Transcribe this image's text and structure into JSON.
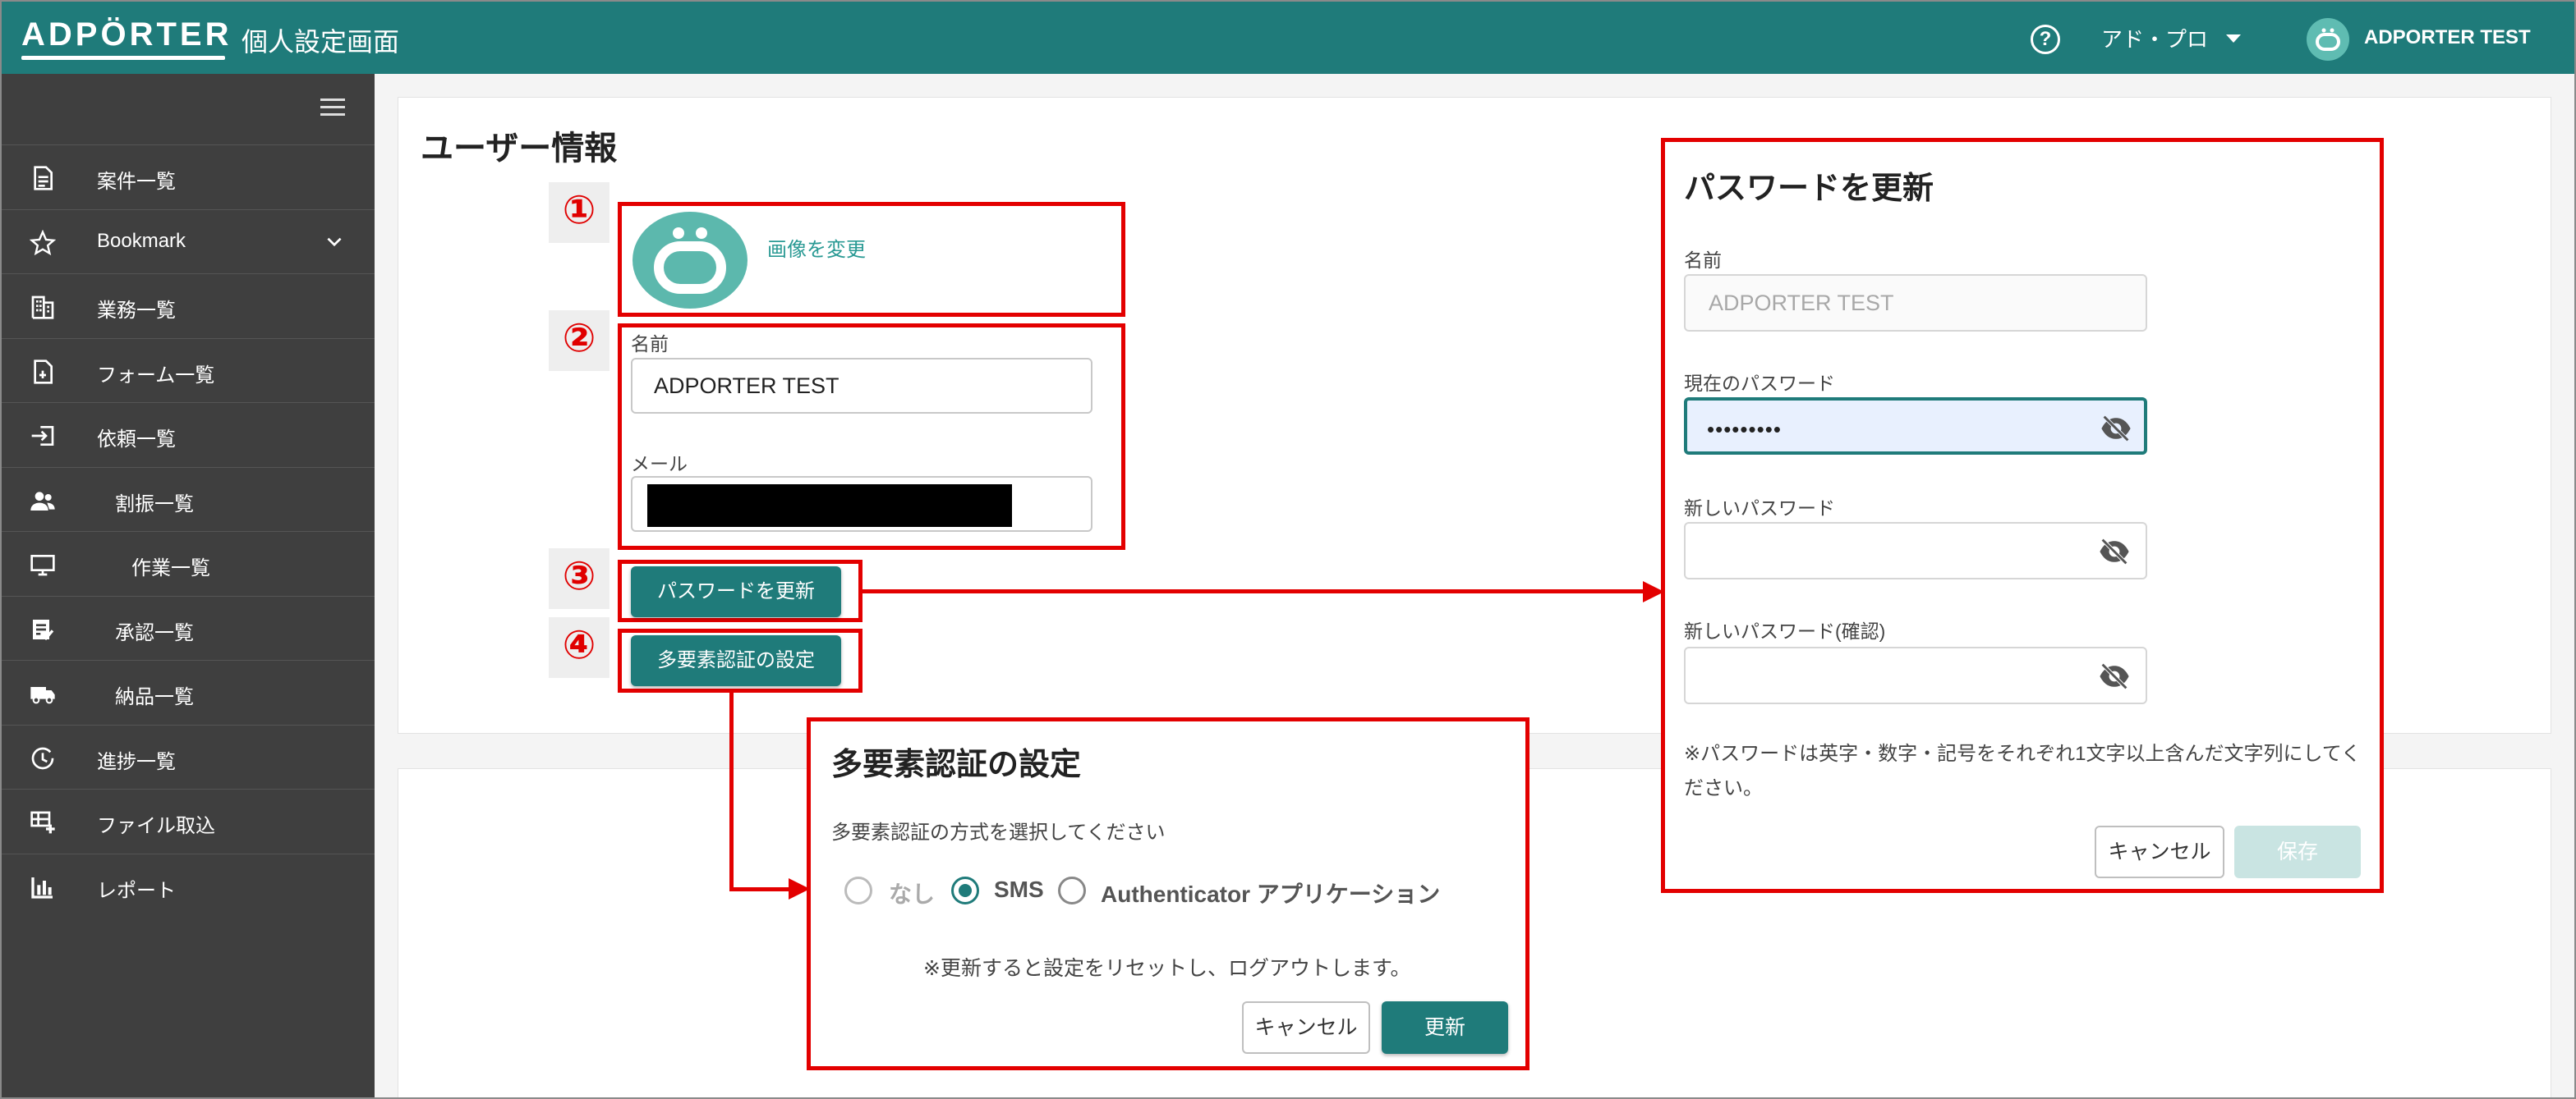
{
  "header": {
    "logo": "ADPÖRTER",
    "title": "個人設定画面",
    "help_icon": "help-circle-icon",
    "org_name": "アド・プロ",
    "user_name": "ADPORTER TEST"
  },
  "sidebar": {
    "items": [
      {
        "label": "案件一覧",
        "icon": "document-icon"
      },
      {
        "label": "Bookmark",
        "icon": "star-icon"
      },
      {
        "label": "業務一覧",
        "icon": "building-icon"
      },
      {
        "label": "フォーム一覧",
        "icon": "form-icon"
      },
      {
        "label": "依頼一覧",
        "icon": "login-icon"
      },
      {
        "label": "割振一覧",
        "icon": "people-icon"
      },
      {
        "label": "作業一覧",
        "icon": "monitor-icon"
      },
      {
        "label": "承認一覧",
        "icon": "approval-icon"
      },
      {
        "label": "納品一覧",
        "icon": "truck-icon"
      },
      {
        "label": "進捗一覧",
        "icon": "history-icon"
      },
      {
        "label": "ファイル取込",
        "icon": "table-add-icon"
      },
      {
        "label": "レポート",
        "icon": "bar-chart-icon"
      }
    ]
  },
  "user_info": {
    "title": "ユーザー情報",
    "change_image": "画像を変更",
    "name_label": "名前",
    "name_value": "ADPORTER TEST",
    "mail_label": "メール",
    "update_password_button": "パスワードを更新",
    "mfa_button": "多要素認証の設定"
  },
  "annotations": [
    "①",
    "②",
    "③",
    "④"
  ],
  "password_panel": {
    "title": "パスワードを更新",
    "name_label": "名前",
    "name_value": "ADPORTER TEST",
    "current_label": "現在のパスワード",
    "current_value": "•••••••••",
    "new_label": "新しいパスワード",
    "confirm_label": "新しいパスワード(確認)",
    "note": "※パスワードは英字・数字・記号をそれぞれ1文字以上含んだ文字列にしてください。",
    "cancel": "キャンセル",
    "save": "保存"
  },
  "mfa_panel": {
    "title": "多要素認証の設定",
    "description": "多要素認証の方式を選択してください",
    "options": [
      {
        "label": "なし",
        "selected": false,
        "disabled": true
      },
      {
        "label": "SMS",
        "selected": true,
        "disabled": false
      },
      {
        "label": "Authenticator アプリケーション",
        "selected": false,
        "disabled": false
      }
    ],
    "note": "※更新すると設定をリセットし、ログアウトします。",
    "cancel": "キャンセル",
    "update": "更新"
  },
  "colors": {
    "brand": "#1f7b7a",
    "sidebar": "#3f3f3f",
    "annotation_red": "#e30000"
  }
}
